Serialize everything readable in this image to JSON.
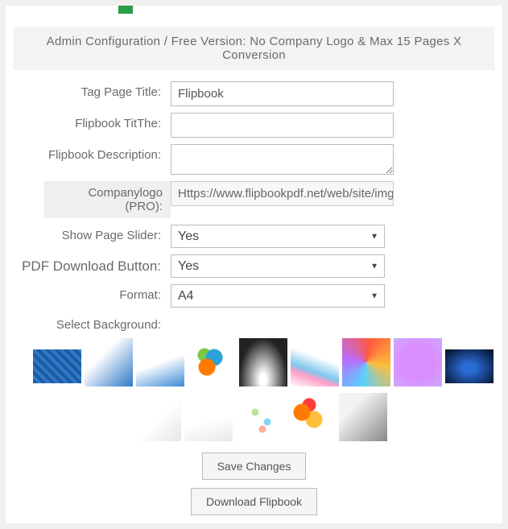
{
  "banner": "Admin Configuration / Free Version: No Company Logo & Max 15 Pages X Conversion",
  "labels": {
    "tag_title": "Tag Page Title:",
    "flip_title": "Flipbook TitThe:",
    "flip_desc": "Flipbook Description:",
    "company_logo": "Companylogo (PRO):",
    "show_slider": "Show Page Slider:",
    "pdf_button": "PDF Download Button:",
    "format": "Format:",
    "select_bg": "Select Background:"
  },
  "values": {
    "tag_title": "Flipbook",
    "flip_title": "",
    "flip_desc": "",
    "company_logo": "Https://www.flipbookpdf.net/web/site/img/logo",
    "show_slider": "Yes",
    "pdf_button": "Yes",
    "format": "A4"
  },
  "buttons": {
    "save": "Save Changes",
    "download": "Download Flipbook"
  },
  "backgrounds": [
    "blue-mosaic",
    "blue-triangles",
    "blue-soft",
    "color-swirl",
    "dark-grid",
    "wave-lines",
    "geo-color",
    "purple-dots",
    "dark-wave",
    "white-cubes",
    "white-wave",
    "dot-confetti",
    "orange-flora",
    "grey-abstract"
  ]
}
